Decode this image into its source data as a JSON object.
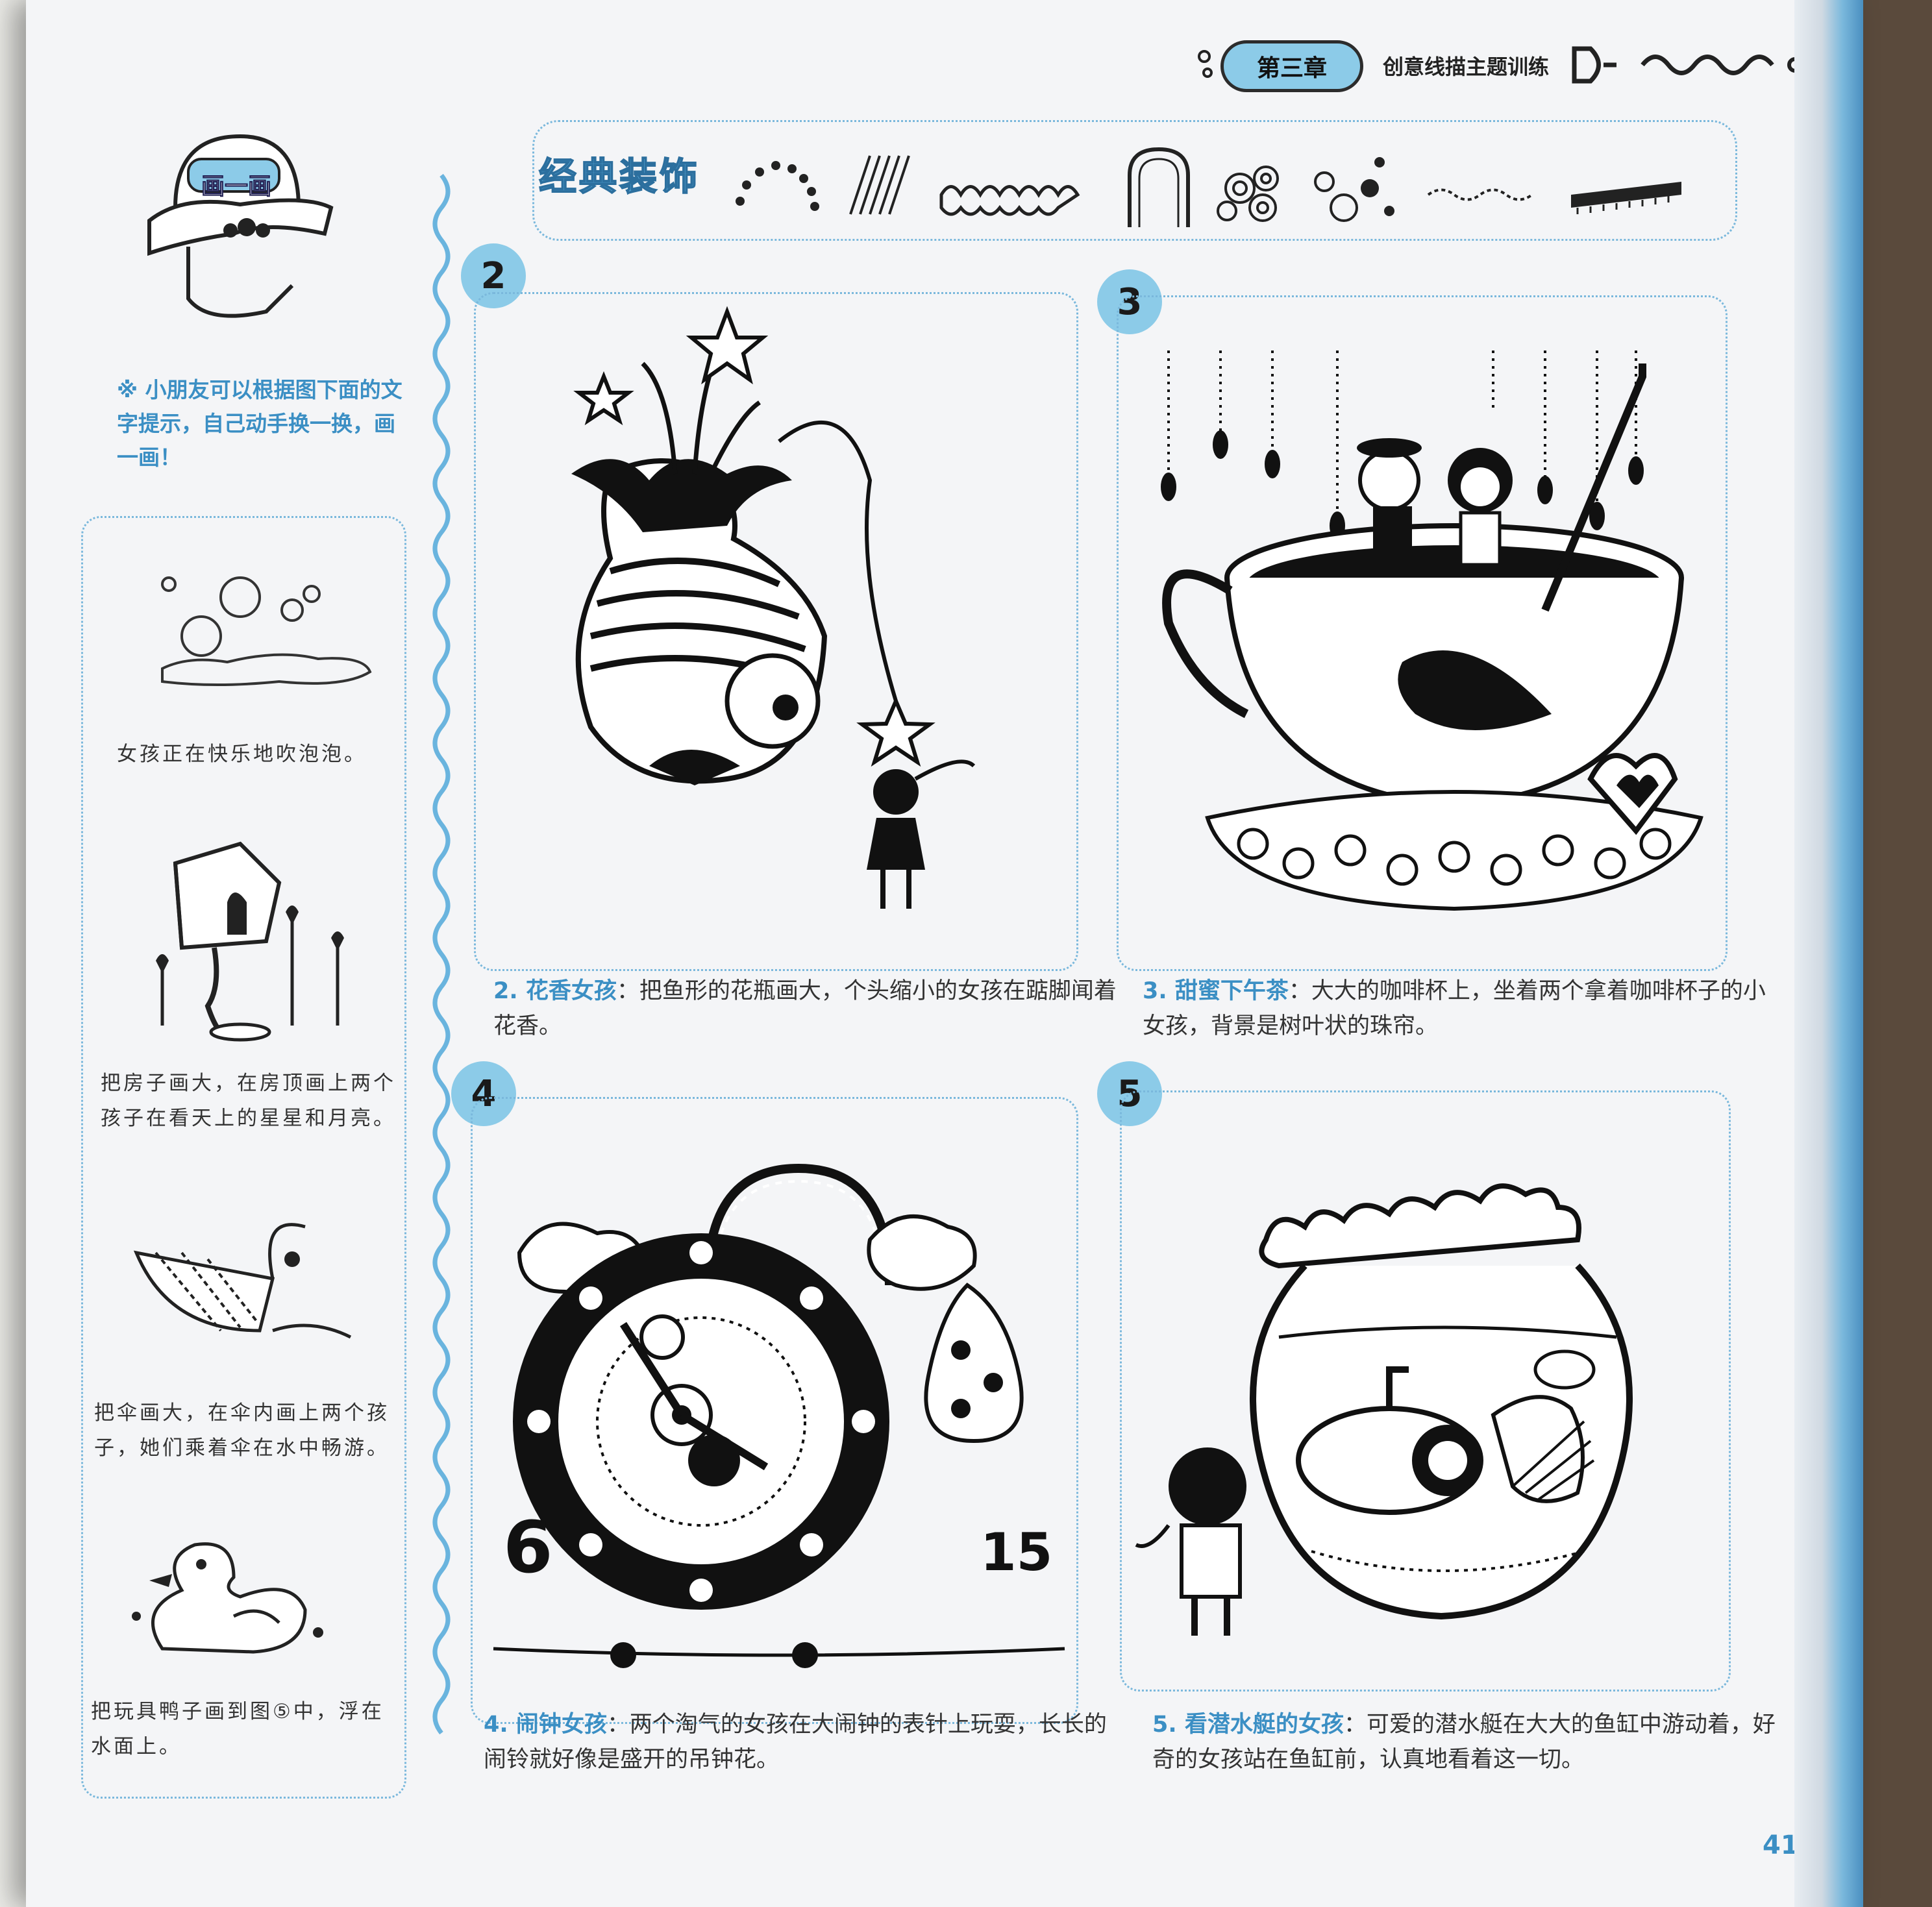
{
  "header": {
    "chapter": "第三章",
    "subtitle": "创意线描主题训练"
  },
  "sidebar": {
    "badge": "画一画",
    "hint": "※ 小朋友可以根据图下面的文字提示，自己动手换一换，画一画！",
    "items": [
      {
        "text": "女孩正在快乐地吹泡泡。"
      },
      {
        "text": "把房子画大，在房顶画上两个孩子在看天上的星星和月亮。"
      },
      {
        "text": "把伞画大，在伞内画上两个孩子，她们乘着伞在水中畅游。"
      },
      {
        "text": "把玩具鸭子画到图⑤中，浮在水面上。"
      }
    ]
  },
  "decorations": {
    "title": "经典装饰"
  },
  "panels": [
    {
      "number": "2",
      "title": "2. 花香女孩",
      "desc": "：把鱼形的花瓶画大，个头缩小的女孩在踮脚闻着花香。"
    },
    {
      "number": "3",
      "title": "3. 甜蜜下午茶",
      "desc": "：大大的咖啡杯上，坐着两个拿着咖啡杯子的小女孩，背景是树叶状的珠帘。"
    },
    {
      "number": "4",
      "title": "4. 闹钟女孩",
      "desc": "：两个淘气的女孩在大闹钟的表针上玩耍，长长的闹铃就好像是盛开的吊钟花。"
    },
    {
      "number": "5",
      "title": "5. 看潜水艇的女孩",
      "desc": "：可爱的潜水艇在大大的鱼缸中游动着，好奇的女孩站在鱼缸前，认真地看着这一切。"
    }
  ],
  "clock_digits": {
    "left": "6",
    "right": "15"
  },
  "page_number": "41",
  "colors": {
    "accent": "#3b8fc4",
    "light_blue": "#8ccbe8",
    "ink": "#1a1a1a"
  }
}
